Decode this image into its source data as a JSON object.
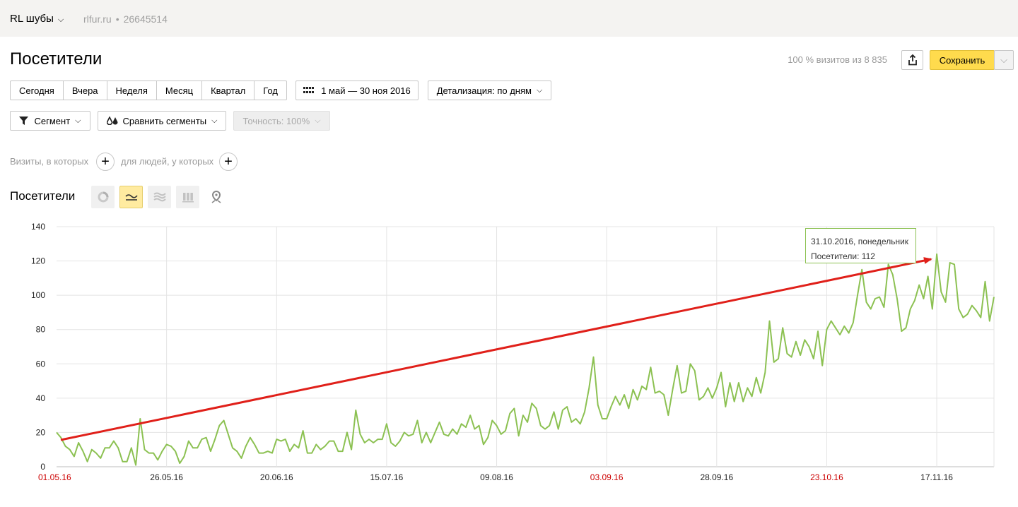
{
  "header": {
    "counter_name": "RL шубы",
    "site": "rlfur.ru",
    "separator": "•",
    "counter_id": "26645514"
  },
  "page": {
    "title": "Посетители",
    "visits_info": "100 % визитов из 8 835",
    "save_label": "Сохранить"
  },
  "periods": [
    "Сегодня",
    "Вчера",
    "Неделя",
    "Месяц",
    "Квартал",
    "Год"
  ],
  "date_range": "1 май — 30 ноя 2016",
  "detail": "Детализация: по дням",
  "segment_label": "Сегмент",
  "compare_label": "Сравнить сегменты",
  "accuracy_label": "Точность: 100%",
  "conditions": {
    "visits": "Визиты, в которых",
    "people": "для людей, у которых"
  },
  "chart_section": {
    "title": "Посетители",
    "chart_types": [
      "pie-chart-icon",
      "line-chart-icon",
      "area-chart-icon",
      "bar-chart-icon",
      "map-icon"
    ],
    "active_type": "line"
  },
  "tooltip": {
    "date": "31.10.2016, понедельник",
    "value": "Посетители: 112"
  },
  "colors": {
    "line": "#8cc152",
    "arrow": "#e0201a",
    "weekend_label": "#cc0000",
    "save": "#ffdb4d"
  },
  "chart_data": {
    "type": "line",
    "ylim": [
      0,
      140
    ],
    "yticks": [
      0,
      20,
      40,
      60,
      80,
      100,
      120,
      140
    ],
    "xtick_labels": [
      {
        "label": "01.05.16",
        "day": 0,
        "weekend": true
      },
      {
        "label": "26.05.16",
        "day": 25,
        "weekend": false
      },
      {
        "label": "20.06.16",
        "day": 50,
        "weekend": false
      },
      {
        "label": "15.07.16",
        "day": 75,
        "weekend": false
      },
      {
        "label": "09.08.16",
        "day": 100,
        "weekend": false
      },
      {
        "label": "03.09.16",
        "day": 125,
        "weekend": true
      },
      {
        "label": "28.09.16",
        "day": 150,
        "weekend": false
      },
      {
        "label": "23.10.16",
        "day": 175,
        "weekend": true
      },
      {
        "label": "17.11.16",
        "day": 200,
        "weekend": false
      }
    ],
    "series": [
      {
        "values": [
          20,
          17,
          12,
          10,
          6,
          14,
          9,
          3,
          10,
          8,
          5,
          11,
          11,
          15,
          11,
          3,
          3,
          11,
          1,
          28,
          10,
          8,
          8,
          4,
          9,
          13,
          12,
          9,
          2,
          6,
          15,
          11,
          11,
          16,
          17,
          9,
          16,
          24,
          27,
          19,
          11,
          9,
          5,
          12,
          17,
          13,
          8,
          8,
          9,
          8,
          16,
          15,
          16,
          9,
          13,
          11,
          21,
          8,
          8,
          13,
          10,
          12,
          15,
          15,
          9,
          9,
          20,
          10,
          33,
          19,
          14,
          16,
          14,
          16,
          16,
          25,
          14,
          12,
          15,
          20,
          18,
          19,
          27,
          14,
          20,
          14,
          20,
          26,
          19,
          18,
          22,
          19,
          25,
          23,
          30,
          22,
          24,
          13,
          17,
          27,
          24,
          19,
          21,
          31,
          34,
          18,
          30,
          26,
          37,
          34,
          24,
          22,
          24,
          32,
          22,
          33,
          35,
          26,
          28,
          25,
          32,
          46,
          64,
          36,
          28,
          28,
          35,
          41,
          36,
          42,
          34,
          45,
          39,
          47,
          45,
          58,
          43,
          44,
          42,
          30,
          45,
          59,
          43,
          44,
          60,
          56,
          39,
          41,
          46,
          40,
          46,
          55,
          35,
          49,
          38,
          49,
          38,
          46,
          41,
          52,
          43,
          55,
          85,
          61,
          63,
          81,
          66,
          64,
          73,
          65,
          74,
          70,
          63,
          79,
          59,
          80,
          85,
          81,
          77,
          82,
          78,
          84,
          100,
          115,
          96,
          92,
          98,
          99,
          93,
          118,
          112,
          98,
          79,
          81,
          92,
          97,
          106,
          98,
          111,
          92,
          124,
          102,
          96,
          119,
          118,
          92,
          87,
          89,
          94,
          91,
          87,
          108,
          85,
          99
        ]
      }
    ]
  }
}
